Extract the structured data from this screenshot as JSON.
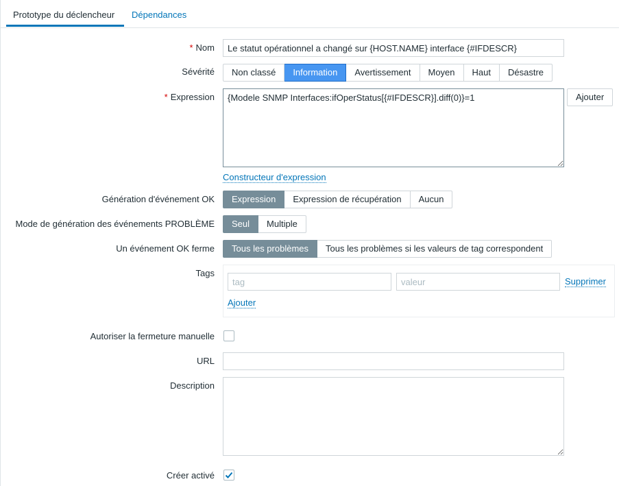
{
  "tabs": {
    "trigger_prototype": "Prototype du déclencheur",
    "dependencies": "Dépendances"
  },
  "form": {
    "name": {
      "label": "Nom",
      "required": "*",
      "value": "Le statut opérationnel a changé sur {HOST.NAME} interface {#IFDESCR}"
    },
    "severity": {
      "label": "Sévérité",
      "options": [
        "Non classé",
        "Information",
        "Avertissement",
        "Moyen",
        "Haut",
        "Désastre"
      ],
      "selected": "Information"
    },
    "expression": {
      "label": "Expression",
      "required": "*",
      "value": "{Modele SNMP Interfaces:ifOperStatus[{#IFDESCR}].diff(0)}=1",
      "add_button": "Ajouter",
      "constructor_link": "Constructeur d'expression"
    },
    "ok_event_generation": {
      "label": "Génération d'événement OK",
      "options": [
        "Expression",
        "Expression de récupération",
        "Aucun"
      ],
      "selected": "Expression"
    },
    "problem_event_mode": {
      "label": "Mode de génération des événements PROBLÈME",
      "options": [
        "Seul",
        "Multiple"
      ],
      "selected": "Seul"
    },
    "ok_event_closes": {
      "label": "Un événement OK ferme",
      "options": [
        "Tous les problèmes",
        "Tous les problèmes si les valeurs de tag correspondent"
      ],
      "selected": "Tous les problèmes"
    },
    "tags": {
      "label": "Tags",
      "tag_placeholder": "tag",
      "value_placeholder": "valeur",
      "remove_link": "Supprimer",
      "add_link": "Ajouter"
    },
    "manual_close": {
      "label": "Autoriser la fermeture manuelle",
      "checked": false
    },
    "url": {
      "label": "URL",
      "value": ""
    },
    "description": {
      "label": "Description",
      "value": ""
    },
    "create_enabled": {
      "label": "Créer activé",
      "checked": true
    }
  },
  "colors": {
    "link": "#0275b8",
    "selected_grey": "#768d99",
    "selected_blue": "#4796f1",
    "required": "#d40000"
  }
}
